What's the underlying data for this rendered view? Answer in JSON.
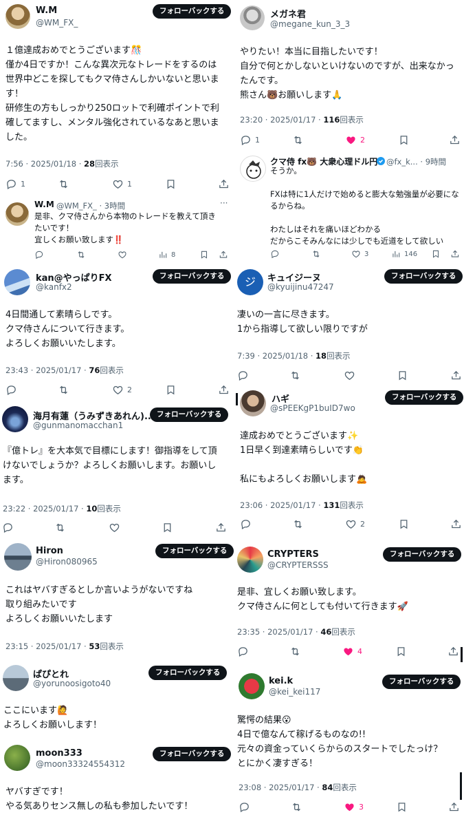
{
  "labels": {
    "follow_back": "フォローバックする",
    "views_suffix": "回表示"
  },
  "tweets": {
    "wm": {
      "name": "W.M",
      "handle": "@WM_FX_",
      "text": "１億達成おめでとうございます🎊\n僅か4日ですか！こんな異次元なトレードをするのは\n世界中どこを探してもクマ侍さんしかいないと思いま\nす！\n研修生の方もしっかり250ロットで利確ポイントで利\n確してますし、メンタル強化されているなあと思いま\nした。",
      "time": "7:56 · 2025/01/18 · ",
      "views": "28",
      "replies": "1",
      "likes": "1"
    },
    "wm_reply": {
      "name": "W.M",
      "handle": "@WM_FX_ · 3時間",
      "text": "是非、クマ侍さんから本物のトレードを教えて頂き\nたいです！\n宜しくお願い致します‼️",
      "views": "8"
    },
    "megane": {
      "name": "メガネ君",
      "handle": "@megane_kun_3_3",
      "text": "やりたい！本当に目指したいです！\n自分で何とかしないといけないのですが、出来なかっ\nたんです。\n熊さん🐻お願いします🙏",
      "time": "23:20 · 2025/01/17 · ",
      "views": "116",
      "replies": "1",
      "likes": "2"
    },
    "kuma": {
      "name": "クマ侍 fx🐻 大衆心理ドル円",
      "handle": "@fx_k... · 9時間",
      "text": "そうか。\n\nFXは特に1人だけで始めると膨大な勉強量が必要にな\nるからね。\n\nわたしはそれを痛いほどわかる\nだからこそみんなには少しでも近道をして欲しい",
      "likes": "3",
      "views": "146"
    },
    "kan": {
      "name": "kan@やっぱりFX",
      "handle": "@kanfx2",
      "text": "4日間通して素晴らしです。\nクマ侍さんについて行きます。\nよろしくお願いいたします。",
      "time": "23:43 · 2025/01/17 · ",
      "views": "76",
      "likes": "2"
    },
    "kyui": {
      "name": "キュイジーヌ",
      "handle": "@kyuijinu47247",
      "avatar_letter": "ジ",
      "text": "凄いの一言に尽きます。\n1から指導して欲しい限りですが",
      "time": "7:39 · 2025/01/18 · ",
      "views": "18"
    },
    "umi": {
      "name": "海月有蓮（うみずきあれん)...",
      "handle": "@gunmanomacchan1",
      "text": "『億トレ』を大本気で目標にします！御指導をして頂\nけないでしょうか？よろしくお願いします。お願いし\nます。",
      "time": "23:22 · 2025/01/17 · ",
      "views": "10"
    },
    "hagi": {
      "name": "ハギ",
      "handle": "@sPEEKgP1buID7wo",
      "text": "達成おめでとうございます✨\n1日早く到達素晴らしいです👏\n\n私にもよろしくお願いします🙇",
      "time": "23:06 · 2025/01/17 · ",
      "views": "131",
      "likes": "2"
    },
    "hiron": {
      "name": "Hiron",
      "handle": "@Hiron080965",
      "text": "これはヤバすぎるとしか言いようがないですね\n取り組みたいです\nよろしくお願いいたします",
      "time": "23:15 · 2025/01/17 · ",
      "views": "53"
    },
    "crypters": {
      "name": "CRYPTERS",
      "handle": "@CRYPTERSSS",
      "text": "是非、宜しくお願い致します。\nクマ侍さんに何としても付いて行きます🚀",
      "time": "23:35 · 2025/01/17 · ",
      "views": "46",
      "likes": "4"
    },
    "papi": {
      "name": "ぱぴとれ",
      "handle": "@yorunoosigoto40",
      "text": "ここにいます🙋\nよろしくお願いします！"
    },
    "moon": {
      "name": "moon333",
      "handle": "@moon33324554312",
      "text": "ヤバすぎです！\nやる気ありセンス無しの私も参加したいです！"
    },
    "kei": {
      "name": "kei.k",
      "handle": "@kei_kei117",
      "text": "驚愕の結果😮\n4日で億なんて稼げるものなの!!\n元々の資金っていくらからのスタートでしたっけ？\nとにかく凄すぎる！",
      "time": "23:08 · 2025/01/17 · ",
      "views": "84",
      "likes": "3"
    }
  },
  "colors": {
    "like_active": "#f91880",
    "verified": "#1d9bf0",
    "kyui_avatar": "#1a5fb4"
  }
}
